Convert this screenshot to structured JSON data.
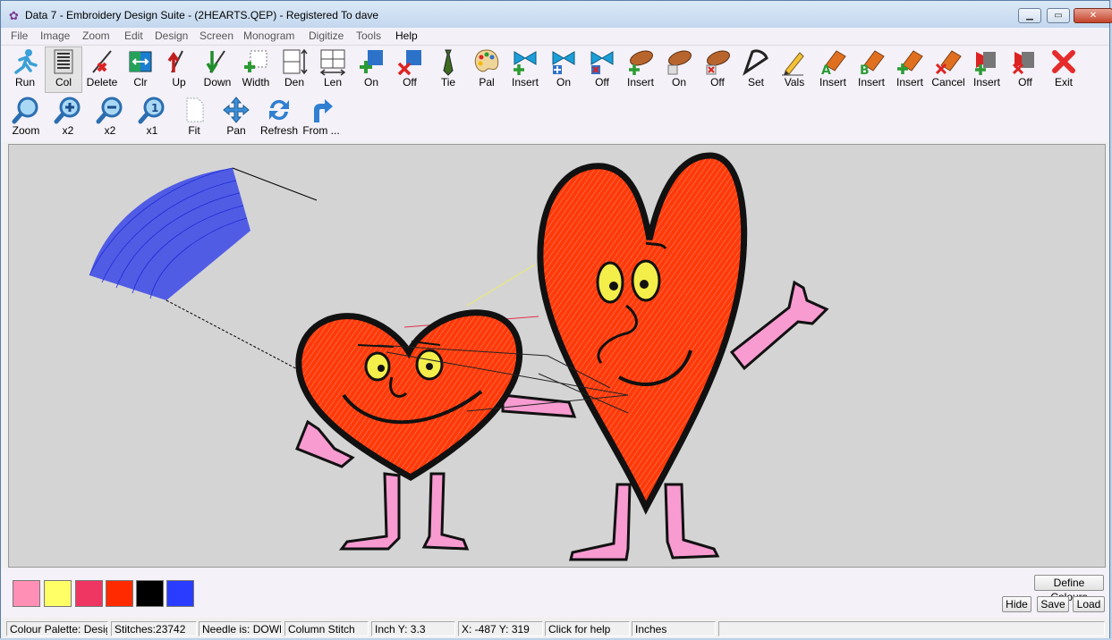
{
  "window": {
    "title": "Data 7 - Embroidery Design Suite - (2HEARTS.QEP) - Registered To dave"
  },
  "menu": [
    {
      "label": "File"
    },
    {
      "label": "Image"
    },
    {
      "label": "Zoom"
    },
    {
      "label": "Edit"
    },
    {
      "label": "Design"
    },
    {
      "label": "Screen"
    },
    {
      "label": "Monogram"
    },
    {
      "label": "Digitize"
    },
    {
      "label": "Tools"
    },
    {
      "label": "Help"
    }
  ],
  "toolbar1": [
    {
      "label": "Run",
      "icon": "runner-icon"
    },
    {
      "label": "Col",
      "icon": "column-stitch-icon"
    },
    {
      "label": "Delete",
      "icon": "delete-stitch-icon"
    },
    {
      "label": "Clr",
      "icon": "color-change-icon"
    },
    {
      "label": "Up",
      "icon": "arrow-up-needle-icon"
    },
    {
      "label": "Down",
      "icon": "arrow-down-needle-icon"
    },
    {
      "label": "Width",
      "icon": "width-icon"
    },
    {
      "label": "Den",
      "icon": "density-icon"
    },
    {
      "label": "Len",
      "icon": "length-icon"
    },
    {
      "label": "On",
      "icon": "plus-square-icon"
    },
    {
      "label": "Off",
      "icon": "minus-square-icon"
    },
    {
      "label": "Tie",
      "icon": "tie-icon"
    },
    {
      "label": "Pal",
      "icon": "palette-icon"
    },
    {
      "label": "Insert",
      "icon": "bow-insert-icon"
    },
    {
      "label": "On",
      "icon": "bow-on-icon"
    },
    {
      "label": "Off",
      "icon": "bow-off-icon"
    },
    {
      "label": "Insert",
      "icon": "bobbin-insert-icon"
    },
    {
      "label": "On",
      "icon": "bobbin-on-icon"
    },
    {
      "label": "Off",
      "icon": "bobbin-off-icon"
    },
    {
      "label": "Set",
      "icon": "protractor-icon"
    },
    {
      "label": "Vals",
      "icon": "pencil-icon"
    },
    {
      "label": "Insert",
      "icon": "eraser-a-icon"
    },
    {
      "label": "Insert",
      "icon": "eraser-b-icon"
    },
    {
      "label": "Insert",
      "icon": "eraser-plus-icon"
    },
    {
      "label": "Cancel",
      "icon": "eraser-cancel-icon"
    },
    {
      "label": "Insert",
      "icon": "stop-insert-icon"
    },
    {
      "label": "Off",
      "icon": "stop-off-icon"
    },
    {
      "label": "Exit",
      "icon": "close-x-icon"
    }
  ],
  "toolbar2": [
    {
      "label": "Zoom",
      "icon": "magnifier-icon"
    },
    {
      "label": "x2",
      "icon": "zoom-in-icon"
    },
    {
      "label": "x2",
      "icon": "zoom-out-icon"
    },
    {
      "label": "x1",
      "icon": "zoom-one-icon"
    },
    {
      "label": "Fit",
      "icon": "page-icon"
    },
    {
      "label": "Pan",
      "icon": "pan-arrows-icon"
    },
    {
      "label": "Refresh",
      "icon": "refresh-icon"
    },
    {
      "label": "From ...",
      "icon": "arrow-turn-icon"
    }
  ],
  "palette": {
    "colors": [
      "#ff8fb4",
      "#ffff66",
      "#ef3561",
      "#ff2a00",
      "#000000",
      "#2a3cff"
    ],
    "define_label": "Define Colours",
    "hide_label": "Hide",
    "save_label": "Save",
    "load_label": "Load"
  },
  "status": {
    "palette": "Colour Palette: Design",
    "stitches": "Stitches:23742",
    "needle": "Needle is: DOWN",
    "stitch_type": "Column Stitch",
    "inch_y": "Inch Y: 3.3",
    "coords": "X: -487 Y: 319",
    "help": "Click for help",
    "units": "Inches"
  }
}
